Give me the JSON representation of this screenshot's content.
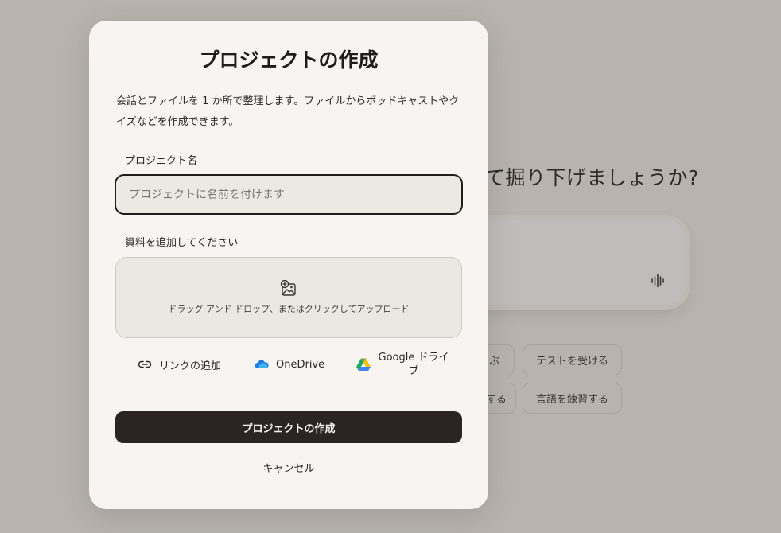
{
  "background": {
    "heading": "て掘り下げましょうか?",
    "voice_icon": "voice-waveform-icon",
    "chips": [
      {
        "label": "ぶ"
      },
      {
        "label": "テストを受ける"
      },
      {
        "label": "する"
      },
      {
        "label": "言語を練習する"
      }
    ]
  },
  "modal": {
    "title": "プロジェクトの作成",
    "description": "会話とファイルを 1 か所で整理します。ファイルからポッドキャストやクイズなどを作成できます。",
    "name_label": "プロジェクト名",
    "name_placeholder": "プロジェクトに名前を付けます",
    "name_value": "",
    "materials_label": "資料を追加してください",
    "dropzone_text": "ドラッグ アンド ドロップ、またはクリックしてアップロード",
    "dropzone_icon": "add-image-icon",
    "sources": {
      "link": {
        "label": "リンクの追加",
        "icon": "link-icon"
      },
      "onedrive": {
        "label": "OneDrive",
        "icon": "onedrive-icon"
      },
      "gdrive": {
        "label": "Google ドライブ",
        "icon": "google-drive-icon"
      }
    },
    "create_label": "プロジェクトの作成",
    "cancel_label": "キャンセル"
  },
  "colors": {
    "overlay_bg": "#b8b3af",
    "modal_bg": "#f7f4f1",
    "primary_button": "#2a2522",
    "input_border": "#1f1c1a"
  }
}
